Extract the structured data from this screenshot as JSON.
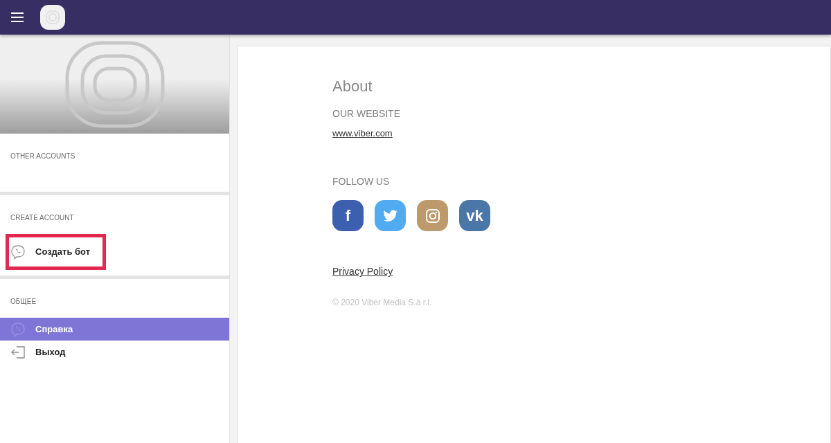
{
  "sidebar": {
    "sections": [
      {
        "title": "OTHER ACCOUNTS"
      },
      {
        "title": "CREATE ACCOUNT",
        "items": [
          {
            "label": "Создать бот",
            "kind": "viber",
            "selected": false,
            "highlighted": true
          }
        ]
      },
      {
        "title": "ОБЩЕЕ",
        "items": [
          {
            "label": "Справка",
            "kind": "viber",
            "selected": true,
            "highlighted": false
          },
          {
            "label": "Выход",
            "kind": "exit",
            "selected": false,
            "highlighted": false
          }
        ]
      }
    ]
  },
  "about": {
    "title": "About",
    "website_heading": "OUR WEBSITE",
    "website_link": "www.viber.com",
    "follow_heading": "FOLLOW US",
    "social": [
      {
        "kind": "facebook",
        "glyph": "f",
        "color": "#3d5fb0"
      },
      {
        "kind": "twitter",
        "color": "#50abf1"
      },
      {
        "kind": "instagram",
        "color": "#bc9a6c"
      },
      {
        "kind": "vk",
        "glyph": "vk",
        "color": "#4a76a8"
      }
    ],
    "privacy_link": "Privacy Policy",
    "copyright": "© 2020 Viber Media S.à r.l."
  }
}
